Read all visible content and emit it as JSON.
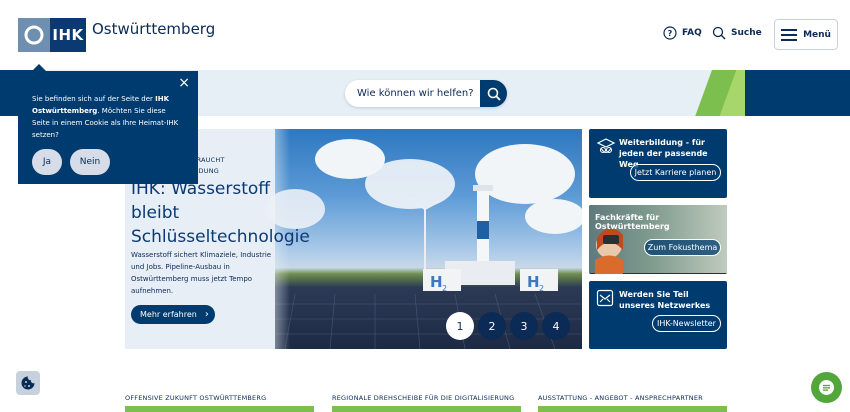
{
  "header": {
    "logo_abbr": "IHK",
    "logo_name": "Ostwürttemberg",
    "faq_label": "FAQ",
    "search_label": "Suche",
    "menu_label": "Menü"
  },
  "search": {
    "placeholder": "Wie können wir helfen?"
  },
  "cookie": {
    "text_pre": "Sie befinden sich auf der Seite der ",
    "text_bold": "IHK Ostwürttemberg",
    "text_post": ". Möchten Sie diese Seite in einem Cookie als Ihre Heimat-IHK setzen?",
    "yes_label": "Ja",
    "no_label": "Nein",
    "close_glyph": "×"
  },
  "hero": {
    "eyebrow_line1": "AFT BRAUCHT",
    "eyebrow_line2": "ANBINDUNG",
    "title": "IHK: Wasserstoff bleibt Schlüsseltechnologie",
    "description": "Wasserstoff sichert Klimaziele, Industrie und Jobs. Pipeline-Ausbau in Ostwürttemberg muss jetzt Tempo aufnehmen.",
    "more_label": "Mehr erfahren",
    "more_arrow": "›",
    "h2_label": "H",
    "h2_sub": "2",
    "slides": [
      "1",
      "2",
      "3",
      "4"
    ],
    "active_slide": 0
  },
  "tiles": [
    {
      "title": "Weiterbildung - für jeden der passende Weg",
      "button": "Jetzt Karriere planen",
      "icon": "graduation-owl-icon"
    },
    {
      "title": "Fachkräfte für Ostwürttemberg",
      "button": "Zum Fokusthema",
      "icon": "binoculars-photo"
    },
    {
      "title": "Werden Sie Teil unseres Netzwerkes",
      "button": "IHK-Newsletter",
      "icon": "newsletter-icon"
    }
  ],
  "bottom_sections": [
    "OFFENSIVE ZUKUNFT OSTWÜRTTEMBERG",
    "REGIONALE DREHSCHEIBE FÜR DIE DIGITALISIERUNG",
    "AUSSTATTUNG - ANGEBOT - ANSPRECHPARTNER"
  ],
  "colors": {
    "brand_dark": "#003b6f",
    "brand_green": "#7dbf4f",
    "chat_green": "#52a63a"
  }
}
